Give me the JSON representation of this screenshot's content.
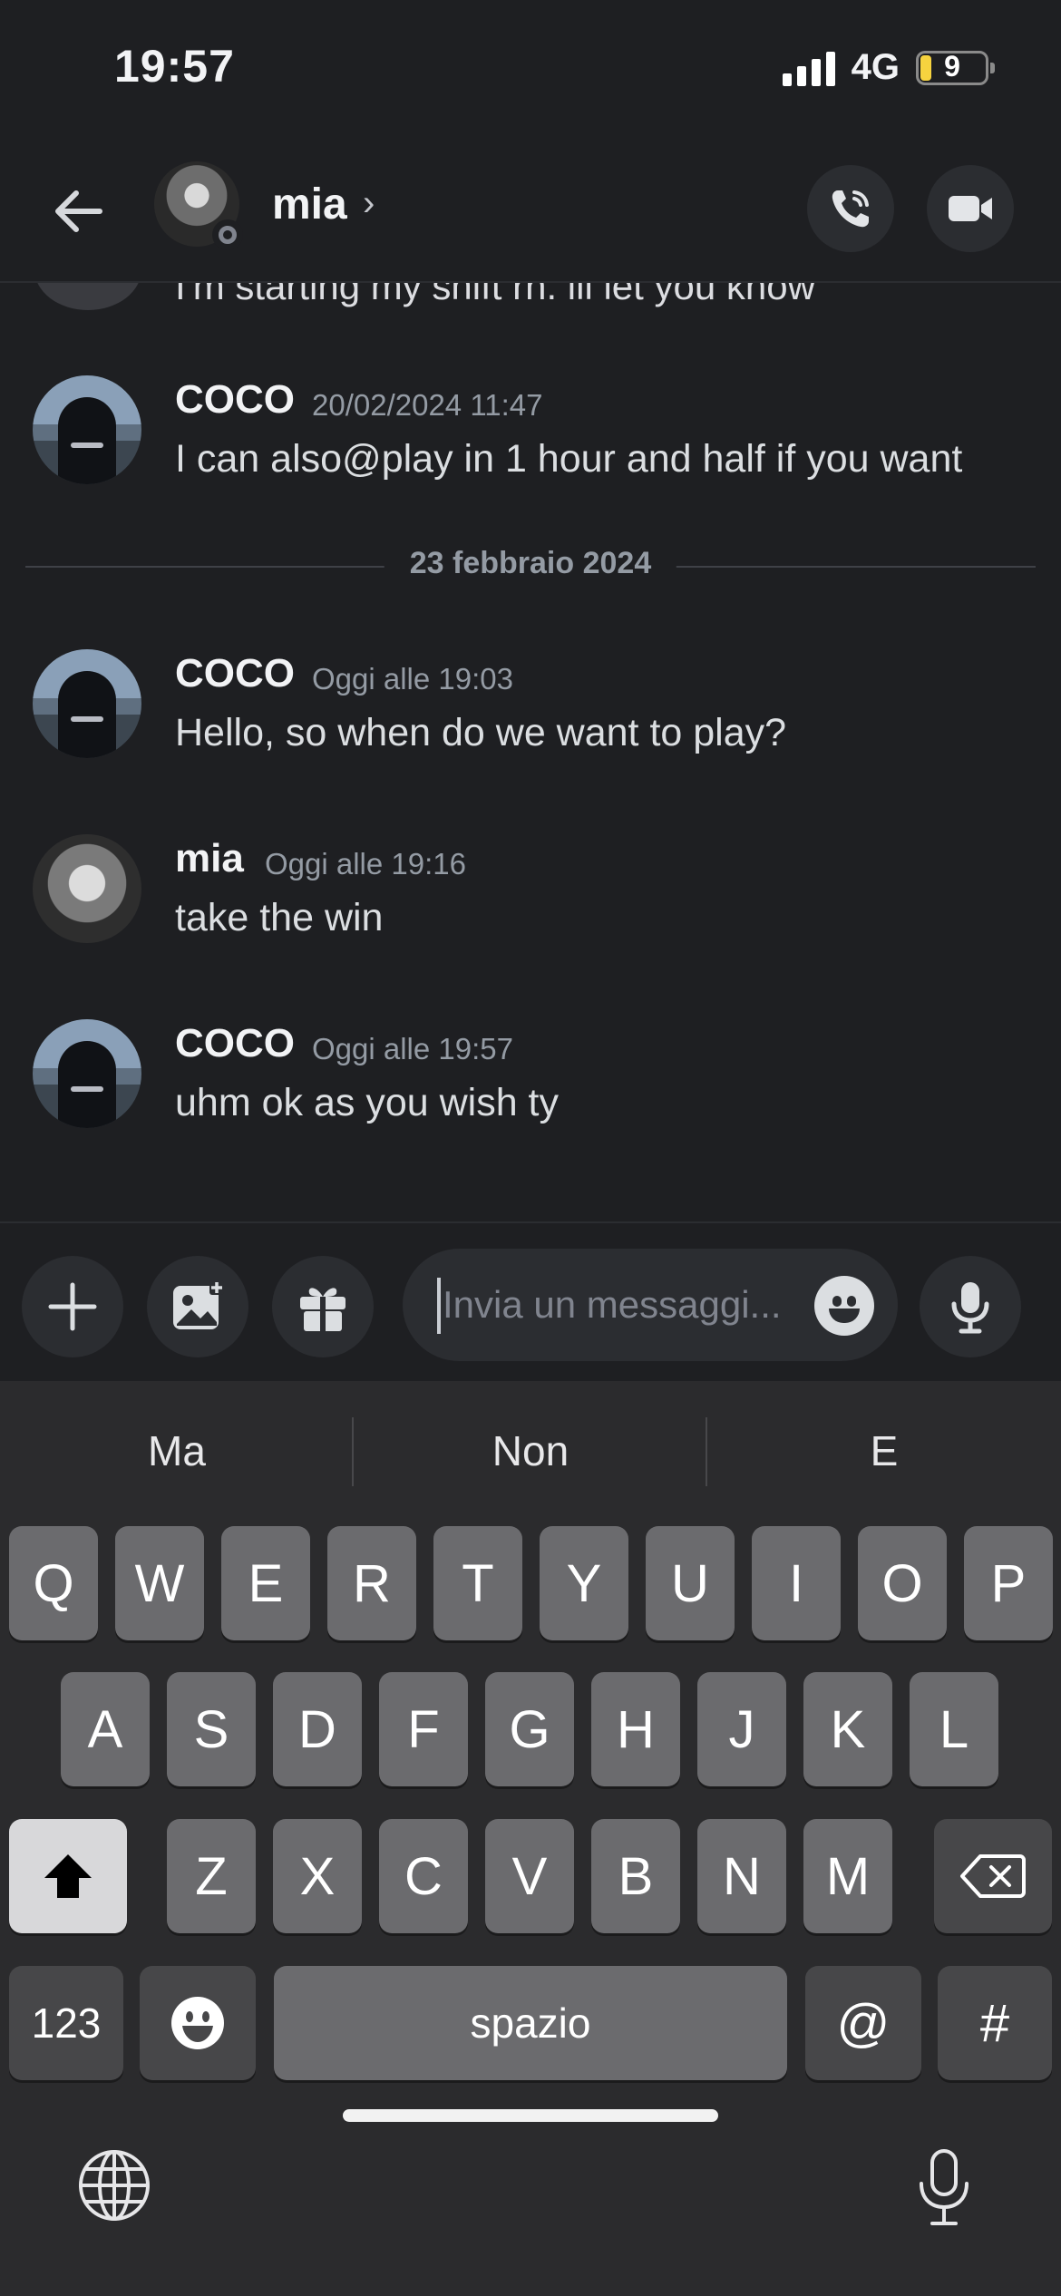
{
  "status_bar": {
    "time": "19:57",
    "network": "4G",
    "battery": "9"
  },
  "header": {
    "name": "mia",
    "chevron": "›"
  },
  "messages": {
    "cut_off_text": "I'm starting my shift rn. ill let you know",
    "items": [
      {
        "user": "COCO",
        "time": "20/02/2024 11:47",
        "text": "I can also@play in 1 hour and half if you want",
        "avatar": "coco"
      },
      {
        "user": "COCO",
        "time": "Oggi alle 19:03",
        "text": "Hello, so when do we want to play?",
        "avatar": "coco"
      },
      {
        "user": "mia",
        "time": "Oggi alle 19:16",
        "text": "take the win",
        "avatar": "mia"
      },
      {
        "user": "COCO",
        "time": "Oggi alle 19:57",
        "text": "uhm ok as you wish ty",
        "avatar": "coco"
      }
    ],
    "date_divider": "23 febbraio 2024"
  },
  "composer": {
    "placeholder": "Invia un messaggi..."
  },
  "keyboard": {
    "suggestions": [
      "Ma",
      "Non",
      "E"
    ],
    "row1": [
      "Q",
      "W",
      "E",
      "R",
      "T",
      "Y",
      "U",
      "I",
      "O",
      "P"
    ],
    "row2": [
      "A",
      "S",
      "D",
      "F",
      "G",
      "H",
      "J",
      "K",
      "L"
    ],
    "row3": [
      "Z",
      "X",
      "C",
      "V",
      "B",
      "N",
      "M"
    ],
    "numbers_key": "123",
    "space_key": "spazio",
    "at_key": "@",
    "hash_key": "#"
  }
}
